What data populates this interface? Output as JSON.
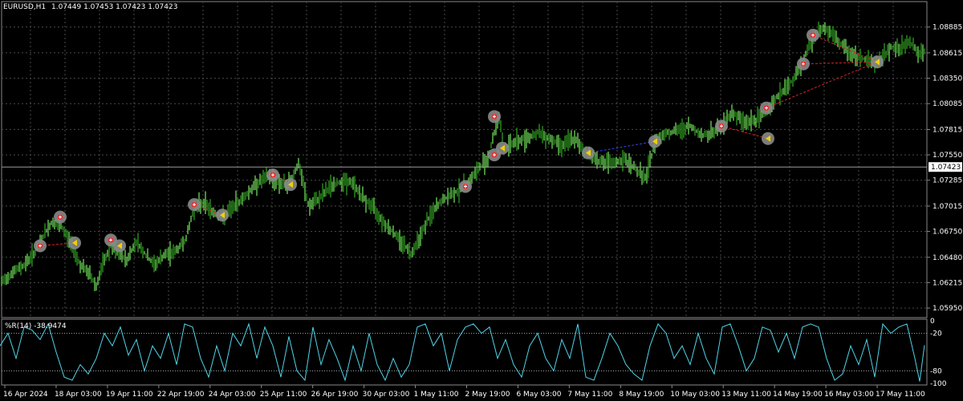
{
  "header": {
    "symbol_timeframe": "EURUSD,H1",
    "ohlc": "1.07449 1.07453 1.07423 1.07423"
  },
  "price_axis": {
    "labels": [
      "1.08885",
      "1.08615",
      "1.08350",
      "1.08085",
      "1.07815",
      "1.07550",
      "1.07285",
      "1.07015",
      "1.06750",
      "1.06480",
      "1.06215",
      "1.05950"
    ],
    "current_price": "1.07423"
  },
  "time_axis": {
    "labels": [
      "16 Apr 2024",
      "18 Apr 03:00",
      "19 Apr 11:00",
      "22 Apr 19:00",
      "24 Apr 03:00",
      "25 Apr 11:00",
      "26 Apr 19:00",
      "30 Apr 03:00",
      "1 May 11:00",
      "2 May 19:00",
      "6 May 03:00",
      "7 May 11:00",
      "8 May 19:00",
      "10 May 03:00",
      "13 May 11:00",
      "14 May 19:00",
      "16 May 03:00",
      "17 May 11:00"
    ]
  },
  "indicator": {
    "label": "%R(14) -38.9474",
    "axis_labels": [
      "0",
      "-20",
      "-80",
      "-100"
    ],
    "color": "#4fd4e8"
  },
  "colors": {
    "background": "#000000",
    "grid": "#4a4a4a",
    "candles": "#2e9b1f",
    "candles_light": "#6ed85a",
    "trade_line_buy": "#3344ff",
    "trade_line_sell": "#dd2222",
    "text": "#ffffff"
  },
  "chart_data": {
    "type": "line",
    "title": "EURUSD,H1",
    "ylim": [
      1.0585,
      1.0905
    ],
    "price_path": [
      [
        0,
        1.062
      ],
      [
        15,
        1.0632
      ],
      [
        30,
        1.064
      ],
      [
        45,
        1.0655
      ],
      [
        55,
        1.0672
      ],
      [
        65,
        1.0685
      ],
      [
        78,
        1.0678
      ],
      [
        90,
        1.066
      ],
      [
        100,
        1.064
      ],
      [
        112,
        1.063
      ],
      [
        120,
        1.0618
      ],
      [
        128,
        1.064
      ],
      [
        138,
        1.066
      ],
      [
        148,
        1.0652
      ],
      [
        158,
        1.0645
      ],
      [
        170,
        1.0665
      ],
      [
        182,
        1.065
      ],
      [
        192,
        1.064
      ],
      [
        205,
        1.065
      ],
      [
        220,
        1.0655
      ],
      [
        232,
        1.0668
      ],
      [
        242,
        1.07
      ],
      [
        255,
        1.0705
      ],
      [
        265,
        1.0695
      ],
      [
        278,
        1.069
      ],
      [
        290,
        1.07
      ],
      [
        305,
        1.0712
      ],
      [
        320,
        1.0725
      ],
      [
        333,
        1.0732
      ],
      [
        345,
        1.0728
      ],
      [
        358,
        1.0722
      ],
      [
        372,
        1.0745
      ],
      [
        385,
        1.07
      ],
      [
        398,
        1.071
      ],
      [
        412,
        1.0722
      ],
      [
        428,
        1.0728
      ],
      [
        440,
        1.0725
      ],
      [
        452,
        1.071
      ],
      [
        465,
        1.07
      ],
      [
        478,
        1.0685
      ],
      [
        492,
        1.0672
      ],
      [
        505,
        1.066
      ],
      [
        512,
        1.0652
      ],
      [
        522,
        1.0668
      ],
      [
        535,
        1.069
      ],
      [
        548,
        1.0705
      ],
      [
        560,
        1.0712
      ],
      [
        575,
        1.072
      ],
      [
        585,
        1.0728
      ],
      [
        598,
        1.0742
      ],
      [
        608,
        1.0752
      ],
      [
        616,
        1.0778
      ],
      [
        622,
        1.0795
      ],
      [
        628,
        1.0762
      ],
      [
        640,
        1.0768
      ],
      [
        655,
        1.0772
      ],
      [
        670,
        1.0778
      ],
      [
        685,
        1.0772
      ],
      [
        700,
        1.0765
      ],
      [
        715,
        1.0772
      ],
      [
        725,
        1.0762
      ],
      [
        735,
        1.0755
      ],
      [
        748,
        1.0748
      ],
      [
        762,
        1.0745
      ],
      [
        778,
        1.075
      ],
      [
        790,
        1.0742
      ],
      [
        805,
        1.073
      ],
      [
        812,
        1.0755
      ],
      [
        818,
        1.0772
      ],
      [
        830,
        1.0778
      ],
      [
        845,
        1.078
      ],
      [
        860,
        1.0785
      ],
      [
        875,
        1.0775
      ],
      [
        888,
        1.0778
      ],
      [
        900,
        1.0785
      ],
      [
        912,
        1.08
      ],
      [
        925,
        1.079
      ],
      [
        940,
        1.079
      ],
      [
        955,
        1.08
      ],
      [
        968,
        1.0815
      ],
      [
        980,
        1.0825
      ],
      [
        992,
        1.0838
      ],
      [
        1000,
        1.085
      ],
      [
        1008,
        1.087
      ],
      [
        1015,
        1.0878
      ],
      [
        1025,
        1.0888
      ],
      [
        1035,
        1.0882
      ],
      [
        1045,
        1.0872
      ],
      [
        1055,
        1.0865
      ],
      [
        1065,
        1.0858
      ],
      [
        1078,
        1.0855
      ],
      [
        1090,
        1.085
      ],
      [
        1100,
        1.0856
      ],
      [
        1110,
        1.0868
      ],
      [
        1122,
        1.0865
      ],
      [
        1133,
        1.0875
      ],
      [
        1145,
        1.086
      ],
      [
        1152,
        1.0862
      ]
    ],
    "trade_markers": [
      {
        "x": 50,
        "y": 1.066,
        "kind": "buy",
        "pair": "s1"
      },
      {
        "x": 93,
        "y": 1.0663,
        "kind": "close",
        "pair": "s1"
      },
      {
        "x": 75,
        "y": 1.069,
        "kind": "buy",
        "pair": "b1"
      },
      {
        "x": 138,
        "y": 1.0666,
        "kind": "buy",
        "pair": "s2"
      },
      {
        "x": 149,
        "y": 1.066,
        "kind": "close",
        "pair": "s2"
      },
      {
        "x": 242,
        "y": 1.0703,
        "kind": "buy",
        "pair": "s3"
      },
      {
        "x": 277,
        "y": 1.0692,
        "kind": "close",
        "pair": "s3"
      },
      {
        "x": 340,
        "y": 1.0734,
        "kind": "buy",
        "pair": "s4"
      },
      {
        "x": 362,
        "y": 1.0724,
        "kind": "close",
        "pair": "s4"
      },
      {
        "x": 580,
        "y": 1.0722,
        "kind": "buy",
        "pair": "b2"
      },
      {
        "x": 616,
        "y": 1.0795,
        "kind": "buy",
        "pair": "s5"
      },
      {
        "x": 616,
        "y": 1.0755,
        "kind": "buy",
        "pair": "b3"
      },
      {
        "x": 626,
        "y": 1.0762,
        "kind": "close",
        "pair": "b3"
      },
      {
        "x": 733,
        "y": 1.0757,
        "kind": "close",
        "pair": "b4"
      },
      {
        "x": 816,
        "y": 1.0769,
        "kind": "close",
        "pair": "b4"
      },
      {
        "x": 899,
        "y": 1.0785,
        "kind": "buy",
        "pair": "s6"
      },
      {
        "x": 957,
        "y": 1.0772,
        "kind": "close",
        "pair": "s6"
      },
      {
        "x": 955,
        "y": 1.0804,
        "kind": "buy",
        "pair": "s7"
      },
      {
        "x": 1001,
        "y": 1.085,
        "kind": "buy",
        "pair": "s8"
      },
      {
        "x": 1013,
        "y": 1.088,
        "kind": "buy",
        "pair": "s9"
      },
      {
        "x": 1093,
        "y": 1.0852,
        "kind": "close",
        "pair": "s9"
      }
    ],
    "wpr_path": [
      [
        0,
        -40
      ],
      [
        10,
        -20
      ],
      [
        20,
        -60
      ],
      [
        30,
        -10
      ],
      [
        40,
        -15
      ],
      [
        50,
        -30
      ],
      [
        60,
        -5
      ],
      [
        70,
        -50
      ],
      [
        80,
        -90
      ],
      [
        90,
        -95
      ],
      [
        100,
        -70
      ],
      [
        110,
        -85
      ],
      [
        120,
        -60
      ],
      [
        130,
        -20
      ],
      [
        140,
        -40
      ],
      [
        150,
        -10
      ],
      [
        160,
        -55
      ],
      [
        170,
        -30
      ],
      [
        180,
        -80
      ],
      [
        190,
        -40
      ],
      [
        200,
        -60
      ],
      [
        210,
        -20
      ],
      [
        220,
        -70
      ],
      [
        230,
        -5
      ],
      [
        240,
        -10
      ],
      [
        250,
        -60
      ],
      [
        260,
        -90
      ],
      [
        270,
        -40
      ],
      [
        280,
        -80
      ],
      [
        290,
        -20
      ],
      [
        300,
        -40
      ],
      [
        310,
        -5
      ],
      [
        320,
        -60
      ],
      [
        330,
        -10
      ],
      [
        340,
        -40
      ],
      [
        350,
        -90
      ],
      [
        360,
        -25
      ],
      [
        370,
        -80
      ],
      [
        380,
        -95
      ],
      [
        390,
        -10
      ],
      [
        400,
        -70
      ],
      [
        410,
        -30
      ],
      [
        420,
        -60
      ],
      [
        430,
        -95
      ],
      [
        440,
        -40
      ],
      [
        450,
        -80
      ],
      [
        460,
        -20
      ],
      [
        470,
        -70
      ],
      [
        480,
        -95
      ],
      [
        490,
        -60
      ],
      [
        500,
        -90
      ],
      [
        510,
        -70
      ],
      [
        520,
        -10
      ],
      [
        530,
        -5
      ],
      [
        540,
        -40
      ],
      [
        550,
        -20
      ],
      [
        560,
        -80
      ],
      [
        570,
        -30
      ],
      [
        580,
        -10
      ],
      [
        590,
        -5
      ],
      [
        600,
        -20
      ],
      [
        610,
        -10
      ],
      [
        620,
        -60
      ],
      [
        630,
        -30
      ],
      [
        640,
        -70
      ],
      [
        650,
        -90
      ],
      [
        660,
        -40
      ],
      [
        670,
        -20
      ],
      [
        680,
        -60
      ],
      [
        690,
        -80
      ],
      [
        700,
        -30
      ],
      [
        710,
        -60
      ],
      [
        720,
        -5
      ],
      [
        730,
        -90
      ],
      [
        740,
        -95
      ],
      [
        750,
        -60
      ],
      [
        760,
        -20
      ],
      [
        770,
        -40
      ],
      [
        780,
        -70
      ],
      [
        790,
        -85
      ],
      [
        800,
        -95
      ],
      [
        810,
        -40
      ],
      [
        820,
        -5
      ],
      [
        830,
        -20
      ],
      [
        840,
        -60
      ],
      [
        850,
        -40
      ],
      [
        860,
        -70
      ],
      [
        870,
        -20
      ],
      [
        880,
        -60
      ],
      [
        890,
        -85
      ],
      [
        900,
        -10
      ],
      [
        910,
        -5
      ],
      [
        920,
        -40
      ],
      [
        930,
        -80
      ],
      [
        940,
        -60
      ],
      [
        950,
        -10
      ],
      [
        960,
        -15
      ],
      [
        970,
        -50
      ],
      [
        980,
        -20
      ],
      [
        990,
        -60
      ],
      [
        1000,
        -10
      ],
      [
        1010,
        -5
      ],
      [
        1020,
        -10
      ],
      [
        1030,
        -60
      ],
      [
        1040,
        -95
      ],
      [
        1050,
        -85
      ],
      [
        1060,
        -40
      ],
      [
        1070,
        -70
      ],
      [
        1080,
        -30
      ],
      [
        1090,
        -90
      ],
      [
        1100,
        -5
      ],
      [
        1110,
        -20
      ],
      [
        1120,
        -10
      ],
      [
        1130,
        -5
      ],
      [
        1140,
        -60
      ],
      [
        1146,
        -97
      ],
      [
        1152,
        -39
      ]
    ],
    "wpr_ylim": [
      -100,
      0
    ]
  }
}
